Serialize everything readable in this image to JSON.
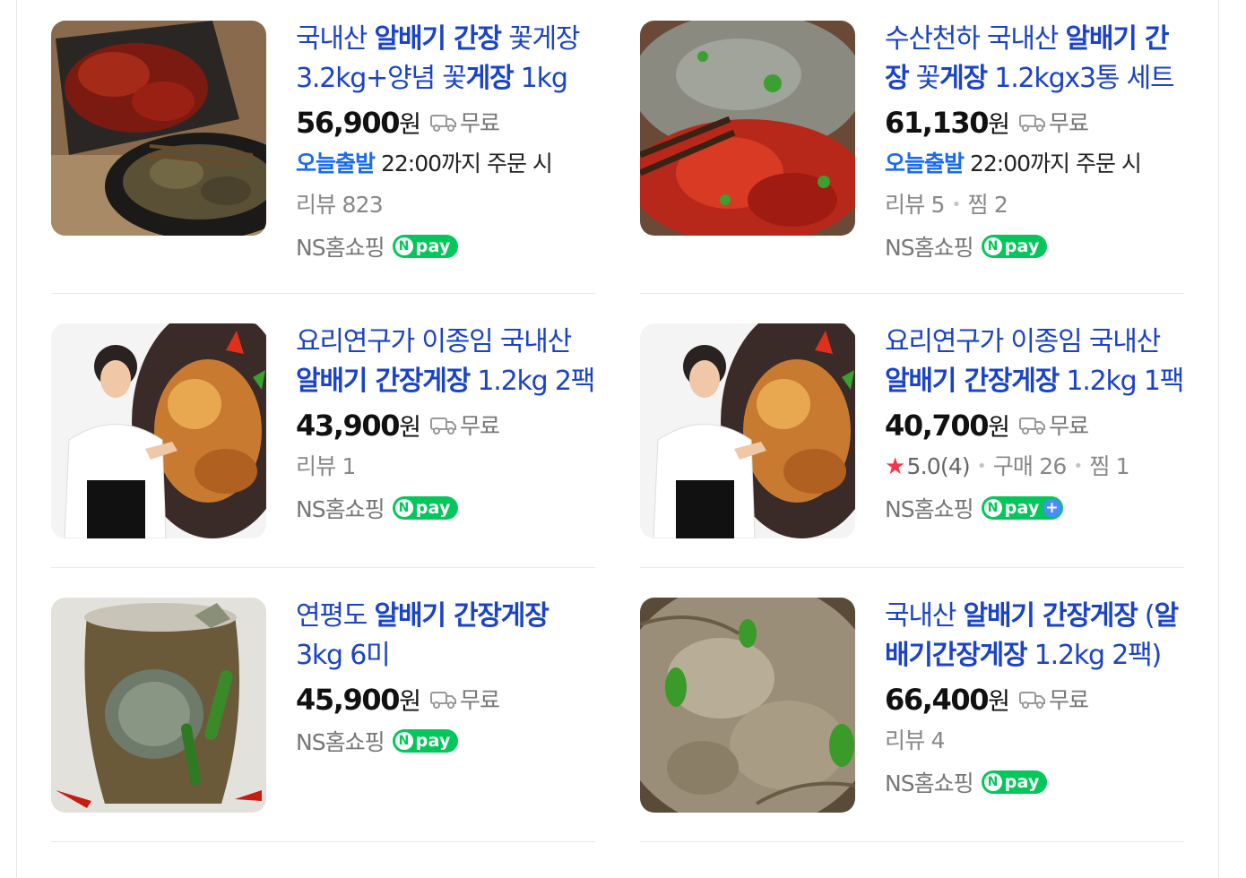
{
  "products": [
    {
      "title_pre": "국내산 ",
      "title_bold": "알배기 간장",
      "title_post": " 꽃게장 3.2kg+양념 꽃",
      "title_bold2": "게장",
      "title_post2": " 1kg",
      "price": "56,900",
      "won": "원",
      "free": "무료",
      "ship_today": "오늘출발",
      "ship_text": " 22:00까지 주문 시",
      "meta": [
        "리뷰 823"
      ],
      "seller": "NS홈쇼핑",
      "npay": "pay",
      "image": "crab-spicy-plate"
    },
    {
      "title_pre": "수산천하 국내산 ",
      "title_bold": "알배기 간장",
      "title_post": " 꽃",
      "title_bold2": "게장",
      "title_post2": " 1.2kgx3통 세트",
      "price": "61,130",
      "won": "원",
      "free": "무료",
      "ship_today": "오늘출발",
      "ship_text": " 22:00까지 주문 시",
      "meta": [
        "리뷰 5",
        "찜 2"
      ],
      "seller": "NS홈쇼핑",
      "npay": "pay",
      "image": "crab-chopsticks"
    },
    {
      "title_pre": "요리연구가 이종임 국내산 ",
      "title_bold": "알배기 간장게장",
      "title_post": " 1.2kg 2팩",
      "title_bold2": "",
      "title_post2": "",
      "price": "43,900",
      "won": "원",
      "free": "무료",
      "meta": [
        "리뷰 1"
      ],
      "seller": "NS홈쇼핑",
      "npay": "pay",
      "image": "chef-crab"
    },
    {
      "title_pre": "요리연구가 이종임 국내산 ",
      "title_bold": "알배기 간장게장",
      "title_post": " 1.2kg 1팩",
      "title_bold2": "",
      "title_post2": "",
      "price": "40,700",
      "won": "원",
      "free": "무료",
      "rating": "5.0(4)",
      "meta": [
        "구매 26",
        "찜 1"
      ],
      "seller": "NS홈쇼핑",
      "npay": "pay",
      "npay_plus": true,
      "image": "chef-crab"
    },
    {
      "title_pre": "연평도 ",
      "title_bold": "알배기 간장게장",
      "title_post": " 3kg 6미",
      "title_bold2": "",
      "title_post2": "",
      "price": "45,900",
      "won": "원",
      "free": "무료",
      "meta": [],
      "seller": "NS홈쇼핑",
      "npay": "pay",
      "image": "crab-jar"
    },
    {
      "title_pre": "국내산 ",
      "title_bold": "알배기 간장게장",
      "title_post": " (",
      "title_bold2": "알배기간장게장",
      "title_post2": " 1.2kg 2팩)",
      "price": "66,400",
      "won": "원",
      "free": "무료",
      "meta": [
        "리뷰 4"
      ],
      "seller": "NS홈쇼핑",
      "npay": "pay",
      "image": "crab-closeup"
    }
  ],
  "colors": {
    "title": "#1a43c8",
    "today": "#1a6bf0",
    "npay": "#03c75a",
    "star": "#f0384c"
  }
}
